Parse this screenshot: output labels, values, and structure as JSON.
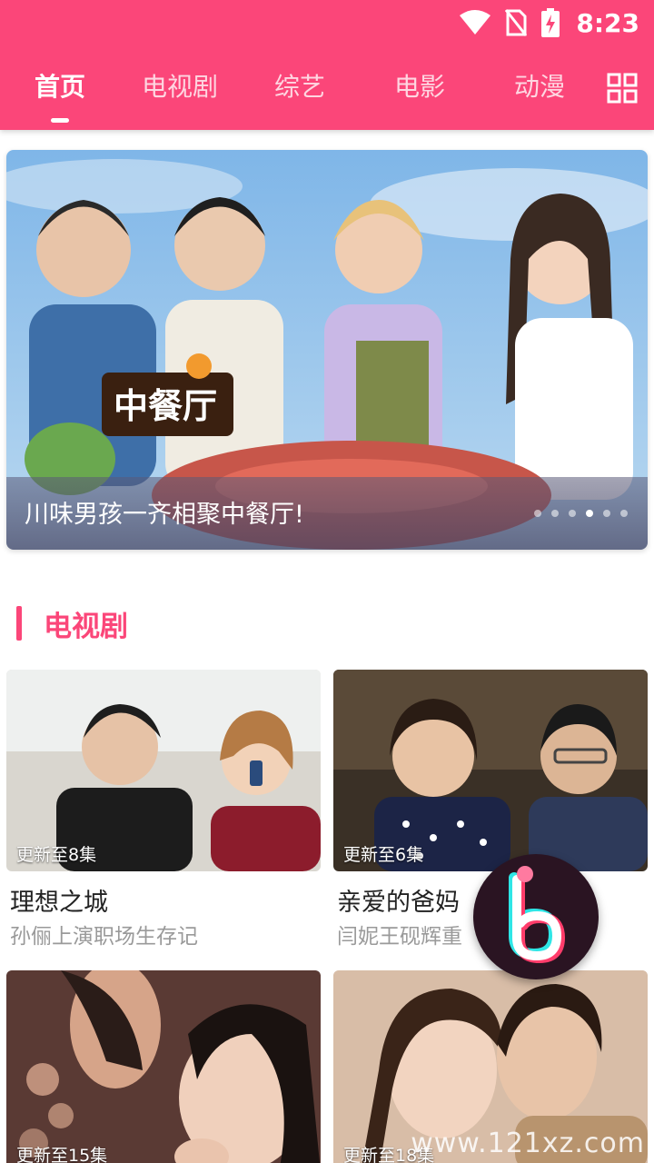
{
  "status": {
    "time": "8:23"
  },
  "tabs": [
    {
      "label": "首页",
      "active": true
    },
    {
      "label": "电视剧"
    },
    {
      "label": "综艺"
    },
    {
      "label": "电影"
    },
    {
      "label": "动漫"
    }
  ],
  "banner": {
    "caption": "川味男孩一齐相聚中餐厅!",
    "logo_text": "中餐厅",
    "slides": 6,
    "active_slide": 4
  },
  "section": {
    "title": "电视剧"
  },
  "cards": [
    {
      "badge": "更新至8集",
      "title": "理想之城",
      "subtitle": "孙俪上演职场生存记"
    },
    {
      "badge": "更新至6集",
      "title": "亲爱的爸妈",
      "subtitle": "闫妮王砚辉重"
    },
    {
      "badge": "更新至15集",
      "title": "",
      "subtitle": ""
    },
    {
      "badge": "更新至18集",
      "title": "",
      "subtitle": ""
    }
  ],
  "watermark": "www.121xz.com",
  "colors": {
    "brand": "#fb4679",
    "title_text": "#222222",
    "subtitle_text": "#9a9a9a"
  }
}
